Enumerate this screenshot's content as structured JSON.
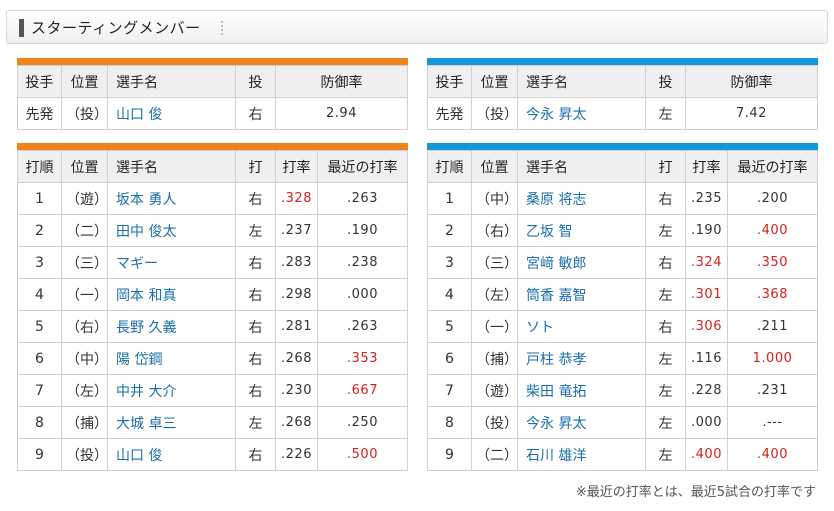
{
  "header": {
    "title": "スターティングメンバー"
  },
  "pitcher_headers": {
    "role": "投手",
    "pos": "位置",
    "name": "選手名",
    "throws": "投",
    "era": "防御率"
  },
  "batting_headers": {
    "order": "打順",
    "pos": "位置",
    "name": "選手名",
    "bats": "打",
    "avg": "打率",
    "recent": "最近の打率"
  },
  "left": {
    "pitcher": {
      "role": "先発",
      "pos": "（投）",
      "name": "山口 俊",
      "throws": "右",
      "era": "2.94"
    },
    "lineup": [
      {
        "order": "1",
        "pos": "（遊）",
        "name": "坂本 勇人",
        "bats": "右",
        "avg": ".328",
        "recent": ".263",
        "avg_red": true,
        "recent_red": false
      },
      {
        "order": "2",
        "pos": "（二）",
        "name": "田中 俊太",
        "bats": "左",
        "avg": ".237",
        "recent": ".190",
        "avg_red": false,
        "recent_red": false
      },
      {
        "order": "3",
        "pos": "（三）",
        "name": "マギー",
        "bats": "右",
        "avg": ".283",
        "recent": ".238",
        "avg_red": false,
        "recent_red": false
      },
      {
        "order": "4",
        "pos": "（一）",
        "name": "岡本 和真",
        "bats": "右",
        "avg": ".298",
        "recent": ".000",
        "avg_red": false,
        "recent_red": false
      },
      {
        "order": "5",
        "pos": "（右）",
        "name": "長野 久義",
        "bats": "右",
        "avg": ".281",
        "recent": ".263",
        "avg_red": false,
        "recent_red": false
      },
      {
        "order": "6",
        "pos": "（中）",
        "name": "陽 岱鋼",
        "bats": "右",
        "avg": ".268",
        "recent": ".353",
        "avg_red": false,
        "recent_red": true
      },
      {
        "order": "7",
        "pos": "（左）",
        "name": "中井 大介",
        "bats": "右",
        "avg": ".230",
        "recent": ".667",
        "avg_red": false,
        "recent_red": true
      },
      {
        "order": "8",
        "pos": "（捕）",
        "name": "大城 卓三",
        "bats": "左",
        "avg": ".268",
        "recent": ".250",
        "avg_red": false,
        "recent_red": false
      },
      {
        "order": "9",
        "pos": "（投）",
        "name": "山口 俊",
        "bats": "右",
        "avg": ".226",
        "recent": ".500",
        "avg_red": false,
        "recent_red": true
      }
    ]
  },
  "right": {
    "pitcher": {
      "role": "先発",
      "pos": "（投）",
      "name": "今永 昇太",
      "throws": "左",
      "era": "7.42"
    },
    "lineup": [
      {
        "order": "1",
        "pos": "（中）",
        "name": "桑原 将志",
        "bats": "右",
        "avg": ".235",
        "recent": ".200",
        "avg_red": false,
        "recent_red": false
      },
      {
        "order": "2",
        "pos": "（右）",
        "name": "乙坂 智",
        "bats": "左",
        "avg": ".190",
        "recent": ".400",
        "avg_red": false,
        "recent_red": true
      },
      {
        "order": "3",
        "pos": "（三）",
        "name": "宮﨑 敏郎",
        "bats": "右",
        "avg": ".324",
        "recent": ".350",
        "avg_red": true,
        "recent_red": true
      },
      {
        "order": "4",
        "pos": "（左）",
        "name": "筒香 嘉智",
        "bats": "左",
        "avg": ".301",
        "recent": ".368",
        "avg_red": true,
        "recent_red": true
      },
      {
        "order": "5",
        "pos": "（一）",
        "name": "ソト",
        "bats": "右",
        "avg": ".306",
        "recent": ".211",
        "avg_red": true,
        "recent_red": false
      },
      {
        "order": "6",
        "pos": "（捕）",
        "name": "戸柱 恭孝",
        "bats": "左",
        "avg": ".116",
        "recent": "1.000",
        "avg_red": false,
        "recent_red": true
      },
      {
        "order": "7",
        "pos": "（遊）",
        "name": "柴田 竜拓",
        "bats": "左",
        "avg": ".228",
        "recent": ".231",
        "avg_red": false,
        "recent_red": false
      },
      {
        "order": "8",
        "pos": "（投）",
        "name": "今永 昇太",
        "bats": "左",
        "avg": ".000",
        "recent": ".---",
        "avg_red": false,
        "recent_red": false
      },
      {
        "order": "9",
        "pos": "（二）",
        "name": "石川 雄洋",
        "bats": "左",
        "avg": ".400",
        "recent": ".400",
        "avg_red": true,
        "recent_red": true
      }
    ]
  },
  "colors": {
    "home_accent": "#f0841c",
    "away_accent": "#1496da",
    "highlight_red": "#d61f1f",
    "name_link": "#1a6fa8"
  },
  "note": "※最近の打率とは、最近5試合の打率です"
}
